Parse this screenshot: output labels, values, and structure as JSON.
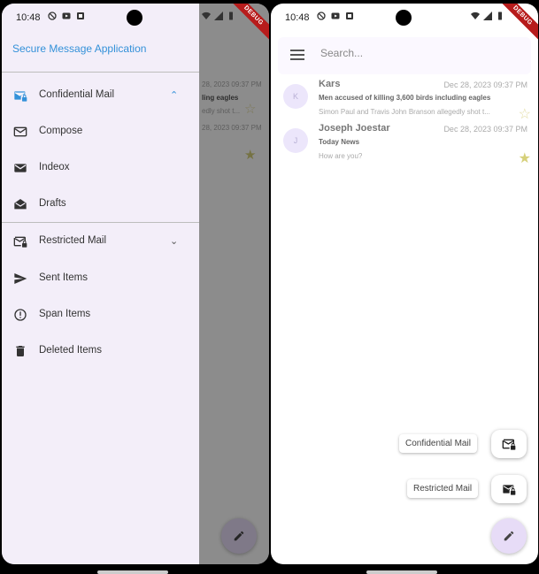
{
  "status": {
    "time": "10:48",
    "debug": "DEBUG"
  },
  "left": {
    "drawer": {
      "title": "Secure Message Application",
      "confidential": {
        "label": "Confidential Mail",
        "icon": "mail-lock-icon",
        "expanded": true,
        "items": [
          {
            "label": "Compose",
            "icon": "mail-outline-icon"
          },
          {
            "label": "Indeox",
            "icon": "mail-filled-icon"
          },
          {
            "label": "Drafts",
            "icon": "drafts-icon"
          }
        ]
      },
      "restricted": {
        "label": "Restricted Mail",
        "icon": "mail-lock-icon",
        "expanded": false
      },
      "items": [
        {
          "label": "Sent Items",
          "icon": "send-icon"
        },
        {
          "label": "Span Items",
          "icon": "report-icon"
        },
        {
          "label": "Deleted Items",
          "icon": "delete-icon"
        }
      ]
    },
    "background": {
      "date1": "28, 2023 09:37 PM",
      "subject1": "ling eagles",
      "preview1": "edly shot t...",
      "date2": "28, 2023 09:37 PM"
    }
  },
  "right": {
    "search_placeholder": "Search...",
    "mails": [
      {
        "avatar": "K",
        "sender": "Kars",
        "date": "Dec 28, 2023 09:37 PM",
        "subject": "Men accused of killing 3,600 birds including eagles",
        "preview": "Simon Paul and Travis John Branson allegedly shot t...",
        "starred": false
      },
      {
        "avatar": "J",
        "sender": "Joseph Joestar",
        "date": "Dec 28, 2023 09:37 PM",
        "subject": "Today News",
        "preview": "How are you?",
        "starred": true
      }
    ],
    "fab_options": [
      {
        "label": "Confidential Mail",
        "icon": "mail-lock-icon"
      },
      {
        "label": "Restricted Mail",
        "icon": "mail-lock-filled-icon"
      }
    ],
    "fab_icon": "edit-icon"
  },
  "colors": {
    "accent": "#3391d9",
    "drawer_bg": "#f3eef9",
    "fab_bg": "#e7dcf7"
  }
}
